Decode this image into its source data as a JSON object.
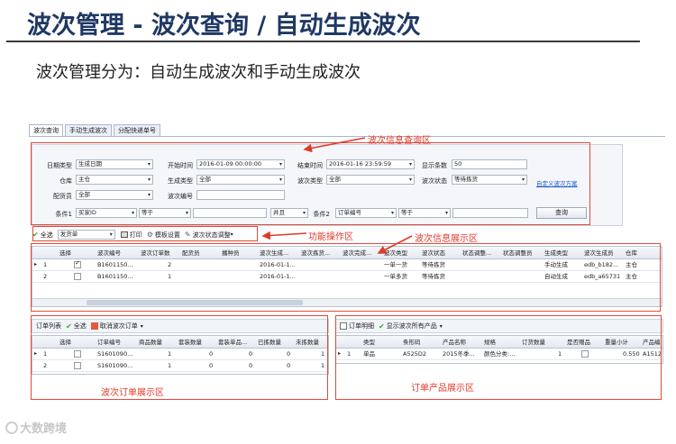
{
  "slide": {
    "title": "波次管理 - 波次查询 / 自动生成波次",
    "subtitle": "波次管理分为：自动生成波次和手动生成波次"
  },
  "tabs": [
    "波次查询",
    "手动生成波次",
    "分配快递单号"
  ],
  "query": {
    "date_type_label": "日期类型",
    "date_type_value": "生成日期",
    "start_time_label": "开始时间",
    "start_time_value": "2016-01-09 00:00:00",
    "end_time_label": "结束时间",
    "end_time_value": "2016-01-16 23:59:59",
    "show_count_label": "显示条数",
    "show_count_value": "50",
    "warehouse_label": "仓库",
    "warehouse_value": "主仓",
    "gen_type_label": "生成类型",
    "gen_type_value": "全部",
    "wave_type_label": "波次类型",
    "wave_type_value": "全部",
    "wave_status_label": "波次状态",
    "wave_status_value": "等待拣货",
    "custom_link": "自定义波次方案",
    "picker_label": "配货员",
    "picker_value": "全部",
    "wave_no_label": "波次编号",
    "wave_no_value": "",
    "cond1_label": "条件1",
    "cond1_field": "买家ID",
    "cond1_op": "等于",
    "cond1_value": "",
    "logic_value": "并且",
    "cond2_label": "条件2",
    "cond2_field": "订单编号",
    "cond2_op": "等于",
    "cond2_value": "",
    "query_button": "查询"
  },
  "toolbar": {
    "select_all": "全选",
    "doc_type": "发货单",
    "print": "打印",
    "template": "模板设置",
    "status_adjust": "波次状态调整"
  },
  "wave_grid": {
    "headers": [
      "选择",
      "波次编号",
      "波次订单数",
      "配货员",
      "播种员",
      "波次生成...",
      "波次拣货...",
      "波次完成...",
      "波次类型",
      "波次状态",
      "状态调整...",
      "状态调整员",
      "生成类型",
      "波次生成员",
      "仓库"
    ],
    "rows": [
      {
        "n": "1",
        "checked": true,
        "wave_no": "B1601150...",
        "count": "2",
        "created": "2016-01-1...",
        "type": "一单一货",
        "status": "等待拣货",
        "gen": "手动生成",
        "creator": "edb_b182...",
        "wh": "主仓"
      },
      {
        "n": "2",
        "checked": false,
        "wave_no": "B1601150...",
        "count": "1",
        "created": "2016-01-1...",
        "type": "一单多货",
        "status": "等待拣货",
        "gen": "自动生成",
        "creator": "edb_a65731",
        "wh": "主仓"
      }
    ]
  },
  "order_panel": {
    "bar_title": "订单列表",
    "select_all": "全选",
    "cancel_order": "取消波次订单",
    "headers": [
      "选择",
      "订单编号",
      "商品数量",
      "套装数量",
      "套装单品...",
      "已拣数量",
      "未拣数量"
    ],
    "rows": [
      {
        "n": "1",
        "order": "S1601090...",
        "qty": "1",
        "set": "0",
        "setitem": "0",
        "picked": "0",
        "unpicked": "1"
      },
      {
        "n": "2",
        "order": "S1601090...",
        "qty": "1",
        "set": "0",
        "setitem": "0",
        "picked": "0",
        "unpicked": "1"
      }
    ]
  },
  "product_panel": {
    "bar_title": "订单明细",
    "show_all": "显示波次所有产品",
    "headers": [
      "类型",
      "条形码",
      "产品名称",
      "规格",
      "订货数量",
      "是否赠品",
      "重量小计",
      "产品编"
    ],
    "rows": [
      {
        "n": "1",
        "type": "单品",
        "barcode": "A525D2",
        "name": "2015冬季...",
        "spec": "颜色分类:...",
        "qty": "1",
        "gift": "",
        "weight": "0.550",
        "code": "A1512"
      }
    ]
  },
  "annotations": {
    "query_area": "波次信息查询区",
    "func_area": "功能操作区",
    "display_area": "波次信息展示区",
    "order_area": "波次订单展示区",
    "product_area": "订单产品展示区",
    "color": "#e03a2a"
  },
  "logo": "大数跨境"
}
